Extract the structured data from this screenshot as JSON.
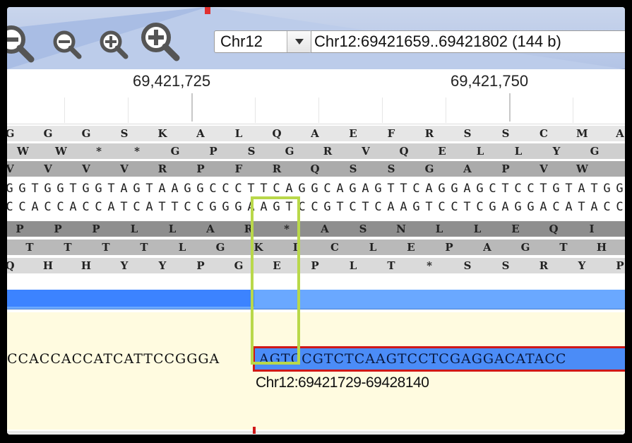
{
  "toolbar": {
    "zoom_buttons": [
      "zoom-out-large",
      "zoom-out",
      "zoom-in",
      "zoom-in-large"
    ],
    "chromosome_select": "Chr12",
    "locus": "Chr12:69421659..69421802 (144 b)"
  },
  "ruler": {
    "labels": [
      "69,421,725",
      "69,421,750"
    ]
  },
  "sequence_tracks": {
    "frame_plus_1": "G G G S K A L Q A E F R S S C M A",
    "frame_plus_2": "W W * * G P S G R V Q E L L Y G",
    "frame_plus_3": "V V V V R P F R Q S S G A P V W",
    "forward_strand": "GGTGGTGGTAGTAAGGCCCTTCAGGCAGAGTTCAGGAGCTCCTGTATGG",
    "reverse_strand": "CCACCACCATCATTCCGGGAAGTCCGTCTCAAGTCCTCGAGGACATACC",
    "frame_minus_1": "P P P L L A R * A S N L L E Q I",
    "frame_minus_2": "T T T T L G K L C L E P A G T H",
    "frame_minus_3": "Q H H Y Y P G E P L T * S S R Y P"
  },
  "feature_track": {
    "left_sequence": "CCACCACCATCATTCCGGGA",
    "feature_sequence": "AGTCCGTCTCAAGTCCTCGAGGACATACC",
    "feature_label": "Chr12:69421729-69428140"
  },
  "colors": {
    "toolbar": "#b8c8e8",
    "feature_fill": "#4b8cf7",
    "feature_border": "#d01818",
    "highlight": "#b9d84a",
    "track_band": "#6aa8ff"
  }
}
